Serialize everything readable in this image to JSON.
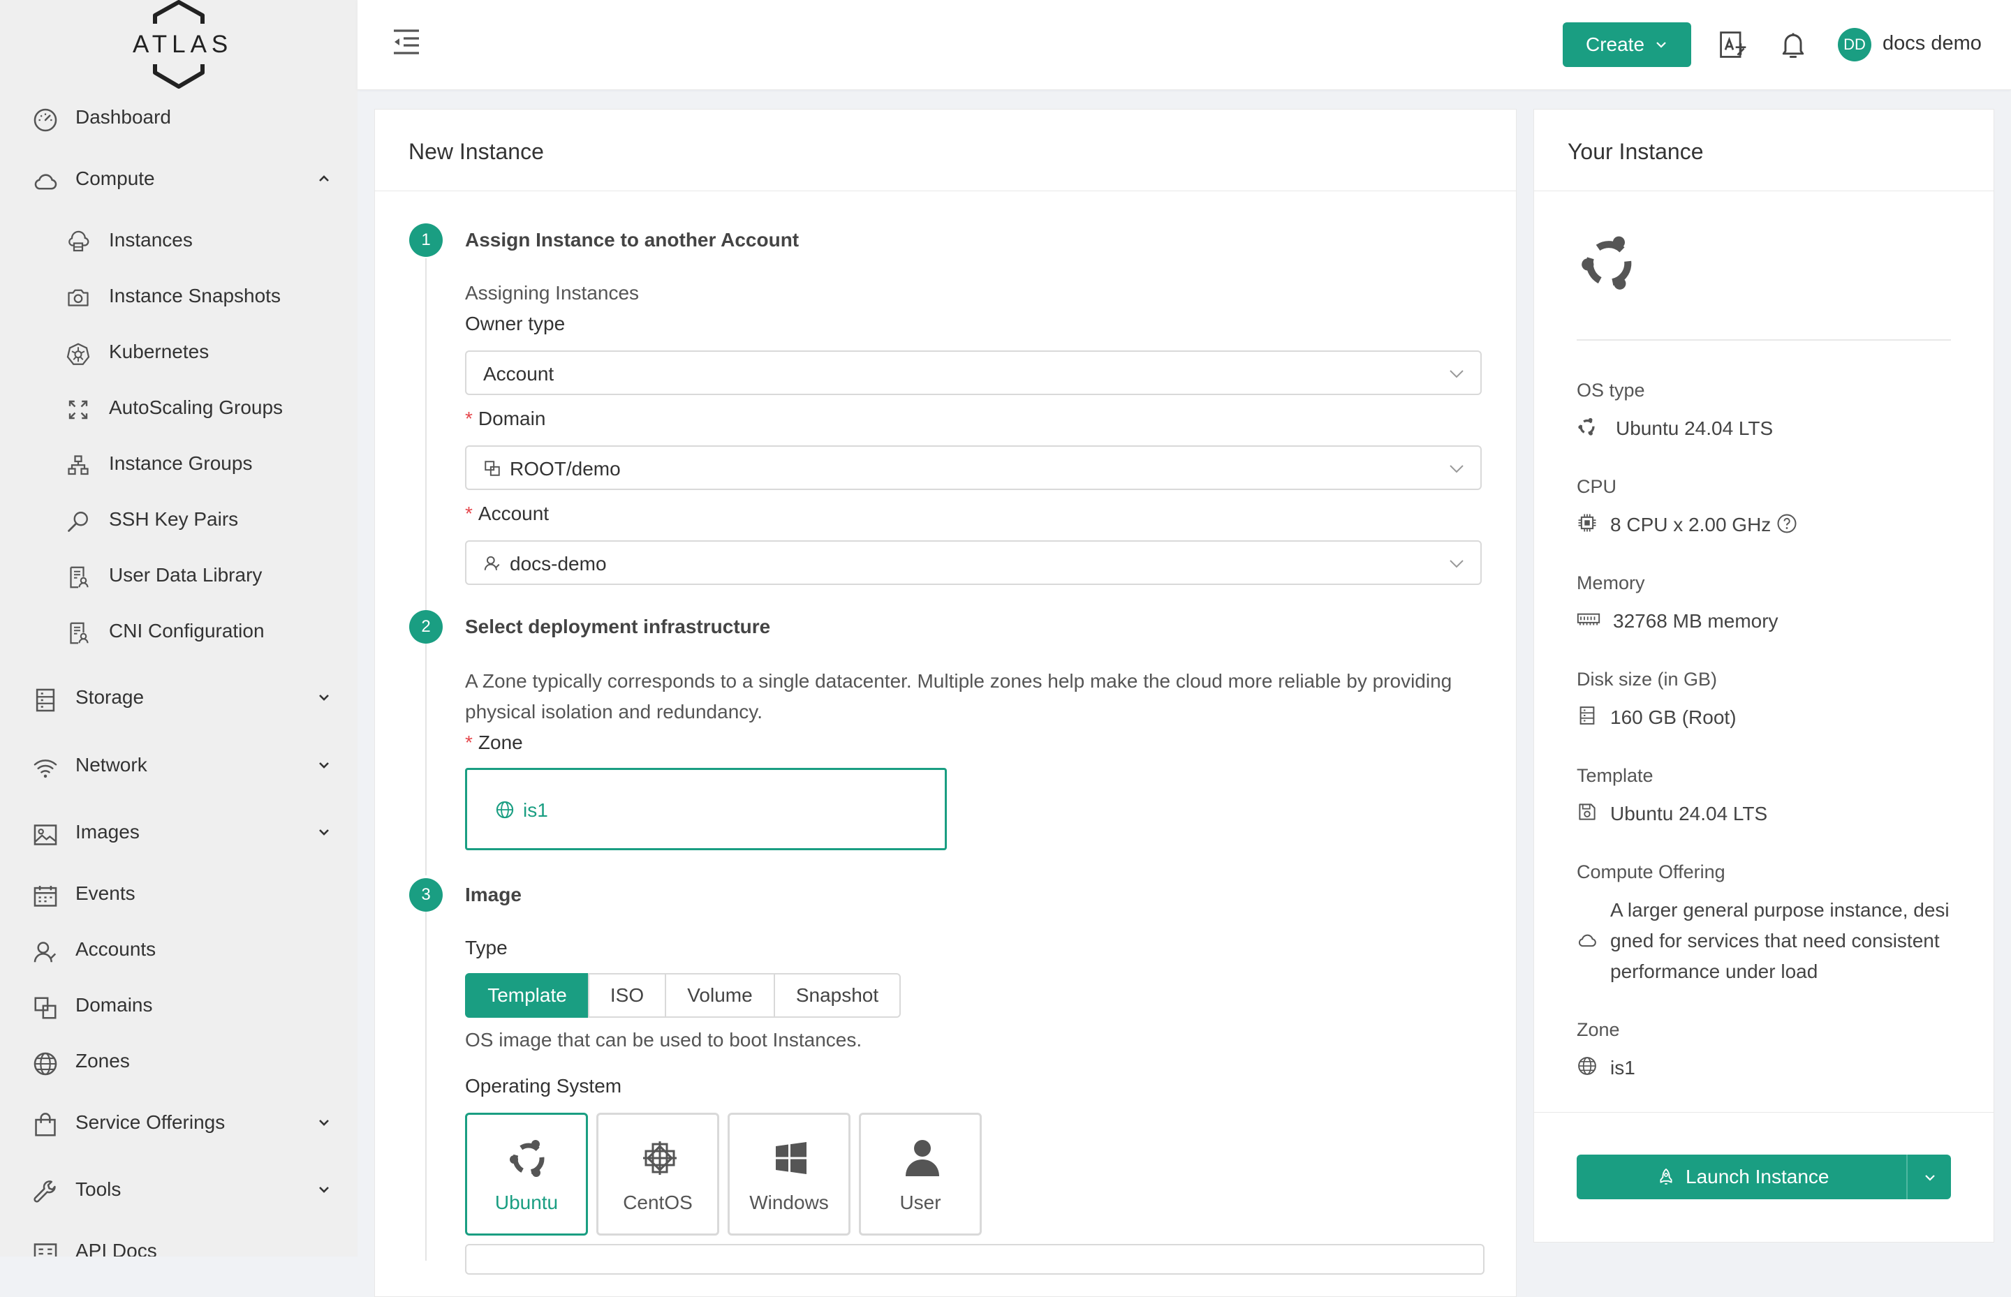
{
  "logo": {
    "text": "ATLAS"
  },
  "sidebar": {
    "items": [
      {
        "label": "Dashboard"
      },
      {
        "label": "Compute"
      },
      {
        "label": "Storage"
      },
      {
        "label": "Network"
      },
      {
        "label": "Images"
      },
      {
        "label": "Events"
      },
      {
        "label": "Accounts"
      },
      {
        "label": "Domains"
      },
      {
        "label": "Zones"
      },
      {
        "label": "Service Offerings"
      },
      {
        "label": "Tools"
      },
      {
        "label": "API Docs"
      }
    ],
    "compute_children": [
      {
        "label": "Instances"
      },
      {
        "label": "Instance Snapshots"
      },
      {
        "label": "Kubernetes"
      },
      {
        "label": "AutoScaling Groups"
      },
      {
        "label": "Instance Groups"
      },
      {
        "label": "SSH Key Pairs"
      },
      {
        "label": "User Data Library"
      },
      {
        "label": "CNI Configuration"
      }
    ]
  },
  "header": {
    "create_label": "Create",
    "user": {
      "initials": "DD",
      "name": "docs demo"
    }
  },
  "form": {
    "title": "New Instance",
    "step1": {
      "number": "1",
      "title": "Assign Instance to another Account",
      "subtitle": "Assigning Instances",
      "owner_type_label": "Owner type",
      "owner_type_value": "Account",
      "domain_label": "Domain",
      "domain_value": "ROOT/demo",
      "account_label": "Account",
      "account_value": "docs-demo"
    },
    "step2": {
      "number": "2",
      "title": "Select deployment infrastructure",
      "description_line1": "A Zone typically corresponds to a single datacenter. Multiple zones help make the cloud more reliable by providing",
      "description_line2": "physical isolation and redundancy.",
      "zone_label": "Zone",
      "zone_value": "is1"
    },
    "step3": {
      "number": "3",
      "title": "Image",
      "type_label": "Type",
      "type_options": [
        "Template",
        "ISO",
        "Volume",
        "Snapshot"
      ],
      "type_selected": "Template",
      "type_description": "OS image that can be used to boot Instances.",
      "os_label": "Operating System",
      "os_options": [
        "Ubuntu",
        "CentOS",
        "Windows",
        "User"
      ],
      "os_selected": "Ubuntu"
    }
  },
  "summary": {
    "title": "Your Instance",
    "os_type_label": "OS type",
    "os_type_value": "Ubuntu 24.04 LTS",
    "cpu_label": "CPU",
    "cpu_value": "8 CPU x 2.00 GHz",
    "memory_label": "Memory",
    "memory_value": "32768 MB memory",
    "disk_label": "Disk size (in GB)",
    "disk_value": "160 GB (Root)",
    "template_label": "Template",
    "template_value": "Ubuntu 24.04 LTS",
    "offering_label": "Compute Offering",
    "offering_line1": "A larger general purpose instance, desi",
    "offering_line2": "gned for services that need consistent",
    "offering_line3": "performance under load",
    "zone_label": "Zone",
    "zone_value": "is1",
    "launch_label": "Launch Instance"
  },
  "colors": {
    "accent": "#1a9e82",
    "required": "#e5484d",
    "sidebar_bg": "#efefef"
  }
}
